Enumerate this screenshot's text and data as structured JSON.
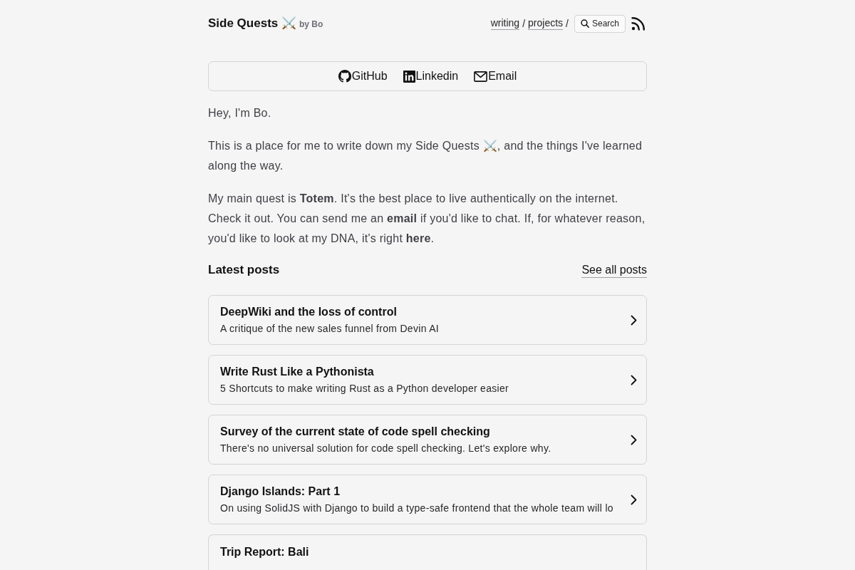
{
  "header": {
    "title": "Side Quests ⚔️",
    "byline": "by Bo",
    "nav": [
      {
        "label": "writing",
        "separator": "/"
      },
      {
        "label": "projects",
        "separator": "/"
      }
    ],
    "search_button": "Search"
  },
  "social_links": [
    {
      "kind": "github",
      "label": "GitHub"
    },
    {
      "kind": "linkedin",
      "label": "Linkedin"
    },
    {
      "kind": "email",
      "label": "Email"
    }
  ],
  "intro": [
    [
      {
        "kind": "text",
        "text": "Hey, I'm Bo."
      }
    ],
    [
      {
        "kind": "text",
        "text": "This is a place for me to write down my Side Quests ⚔️, and the things I've learned along the way."
      }
    ],
    [
      {
        "kind": "text",
        "text": "My main quest is "
      },
      {
        "kind": "link",
        "text": "Totem"
      },
      {
        "kind": "text",
        "text": ". It's the best place to live authentically on the internet. Check it out. You can send me an "
      },
      {
        "kind": "link",
        "text": "email"
      },
      {
        "kind": "text",
        "text": " if you'd like to chat. If, for whatever reason, you'd like to look at my DNA, it's right "
      },
      {
        "kind": "link",
        "text": "here"
      },
      {
        "kind": "text",
        "text": "."
      }
    ]
  ],
  "latest_posts": {
    "heading": "Latest posts",
    "see_all": "See all posts",
    "posts": [
      {
        "title": "DeepWiki and the loss of control",
        "description": "A critique of the new sales funnel from Devin AI"
      },
      {
        "title": "Write Rust Like a Pythonista",
        "description": "5 Shortcuts to make writing Rust as a Python developer easier"
      },
      {
        "title": "Survey of the current state of code spell checking",
        "description": "There's no universal solution for code spell checking. Let's explore why."
      },
      {
        "title": "Django Islands: Part 1",
        "description": "On using SolidJS with Django to build a type-safe frontend that the whole team will lo"
      },
      {
        "title": "Trip Report: Bali"
      }
    ]
  }
}
